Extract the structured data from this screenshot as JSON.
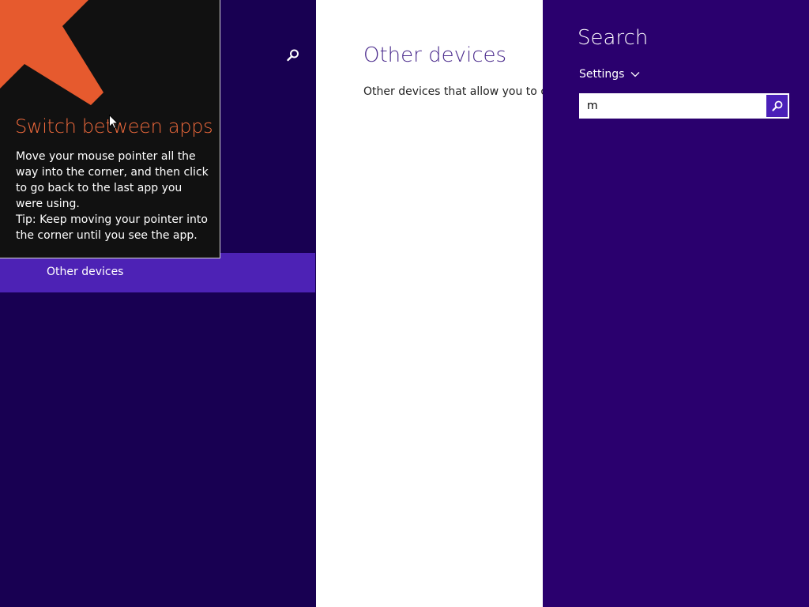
{
  "left_pane": {
    "selected_nav_label": "Other devices",
    "search_icon": "search-icon"
  },
  "content": {
    "title": "Other devices",
    "description": "Other devices that allow you to control your PC"
  },
  "charm": {
    "title": "Search",
    "scope_label": "Settings",
    "scope_icon": "chevron-down-icon",
    "search_value": "m",
    "search_button_icon": "search-icon"
  },
  "tip": {
    "heading": "Switch between apps",
    "body_line1": "Move your mouse pointer all the way into the corner, and then click to go back to the last app you were using.",
    "body_line2": "Tip: Keep moving your pointer into the corner until you see the app.",
    "arrow_color": "#e65a2e",
    "heading_color": "#f06a3c"
  },
  "colors": {
    "left_pane_bg": "#180052",
    "nav_selected_bg": "#4d22b5",
    "charm_bg": "#2a006e",
    "search_button_bg": "#4a1fb8"
  }
}
